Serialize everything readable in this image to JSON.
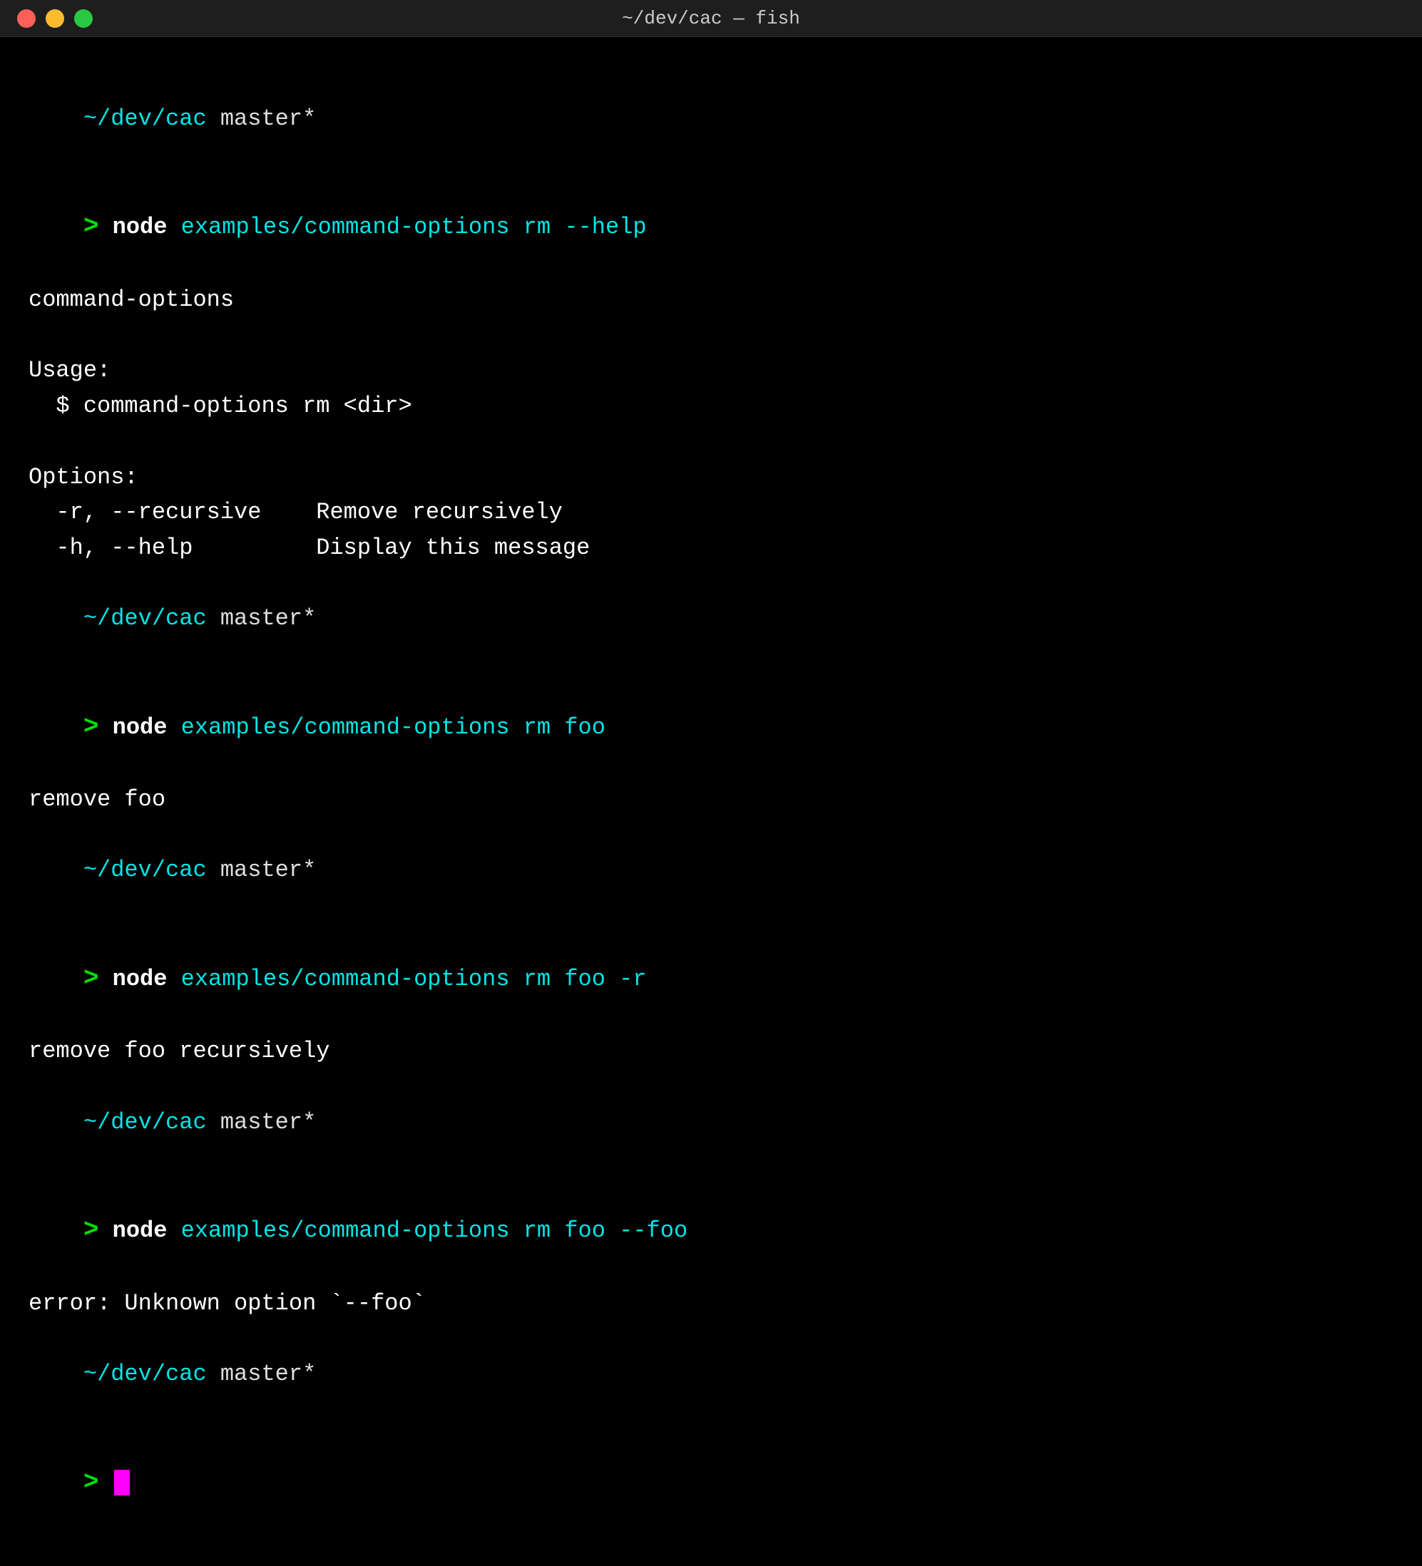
{
  "titlebar": {
    "title": "~/dev/cac — fish",
    "buttons": {
      "red": "close",
      "yellow": "minimize",
      "green": "maximize"
    }
  },
  "terminal": {
    "lines": [
      {
        "type": "prompt",
        "path": "~/dev/cac",
        "branch": "master*"
      },
      {
        "type": "command",
        "arrow": ">",
        "node": "node",
        "rest": " examples/command-options rm --help"
      },
      {
        "type": "output",
        "text": "command-options"
      },
      {
        "type": "empty"
      },
      {
        "type": "output",
        "text": "Usage:"
      },
      {
        "type": "output",
        "text": "  $ command-options rm <dir>"
      },
      {
        "type": "empty"
      },
      {
        "type": "output",
        "text": "Options:"
      },
      {
        "type": "output",
        "text": "  -r, --recursive    Remove recursively"
      },
      {
        "type": "output",
        "text": "  -h, --help         Display this message"
      },
      {
        "type": "prompt",
        "path": "~/dev/cac",
        "branch": "master*"
      },
      {
        "type": "command",
        "arrow": ">",
        "node": "node",
        "rest": " examples/command-options rm foo"
      },
      {
        "type": "output",
        "text": "remove foo"
      },
      {
        "type": "prompt",
        "path": "~/dev/cac",
        "branch": "master*"
      },
      {
        "type": "command",
        "arrow": ">",
        "node": "node",
        "rest": " examples/command-options rm foo -r"
      },
      {
        "type": "output",
        "text": "remove foo recursively"
      },
      {
        "type": "prompt",
        "path": "~/dev/cac",
        "branch": "master*"
      },
      {
        "type": "command",
        "arrow": ">",
        "node": "node",
        "rest": " examples/command-options rm foo --foo"
      },
      {
        "type": "output",
        "text": "error: Unknown option `--foo`"
      },
      {
        "type": "prompt",
        "path": "~/dev/cac",
        "branch": "master*"
      },
      {
        "type": "input_prompt"
      }
    ]
  }
}
